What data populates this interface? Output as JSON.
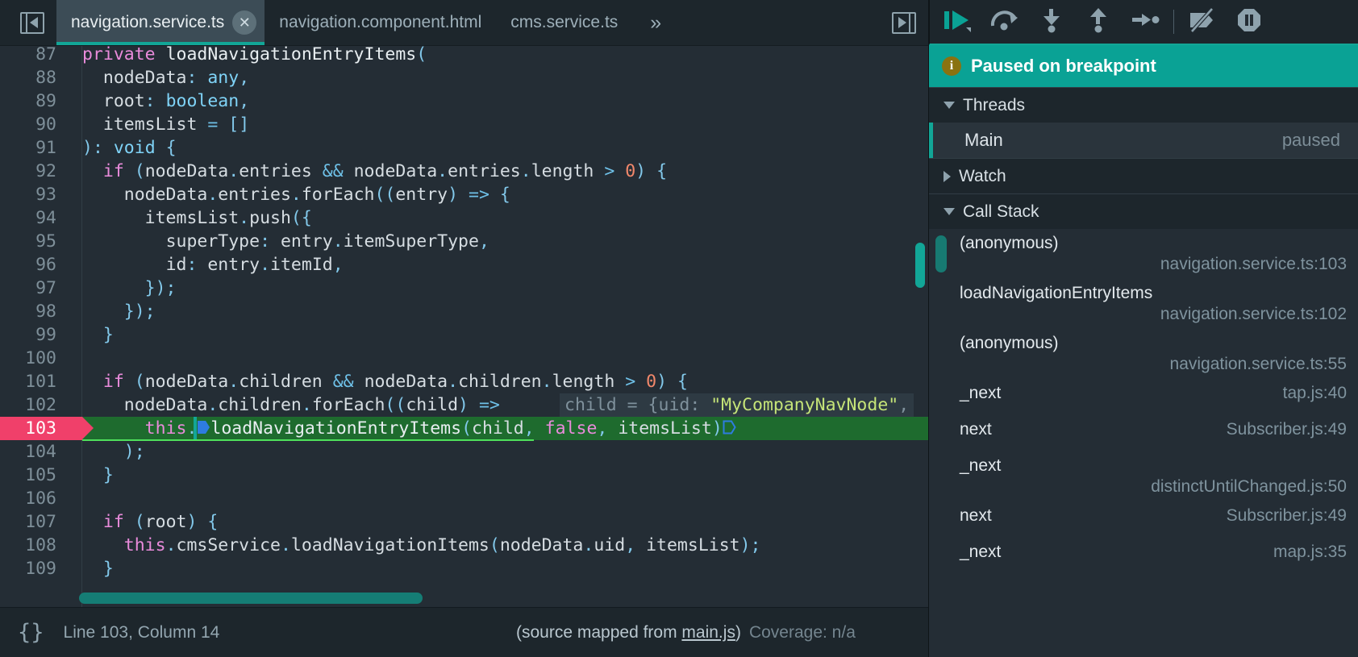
{
  "tabs": {
    "items": [
      {
        "label": "navigation.service.ts",
        "active": true,
        "closable": true
      },
      {
        "label": "navigation.component.html",
        "active": false,
        "closable": false
      },
      {
        "label": "cms.service.ts",
        "active": false,
        "closable": false
      }
    ],
    "more_label": "»",
    "close_glyph": "✕",
    "left_icon": "show-navigator-icon",
    "right_icon": "show-debugger-icon"
  },
  "editor": {
    "first_line_partial": "private loadNavigationEntryItems(",
    "lines": [
      {
        "no": "87",
        "partial": true
      },
      {
        "no": "88"
      },
      {
        "no": "89"
      },
      {
        "no": "90"
      },
      {
        "no": "91"
      },
      {
        "no": "92"
      },
      {
        "no": "93"
      },
      {
        "no": "94"
      },
      {
        "no": "95"
      },
      {
        "no": "96"
      },
      {
        "no": "97"
      },
      {
        "no": "98"
      },
      {
        "no": "99"
      },
      {
        "no": "100"
      },
      {
        "no": "101"
      },
      {
        "no": "102"
      },
      {
        "no": "103",
        "executing": true,
        "breakpoint": true
      },
      {
        "no": "104"
      },
      {
        "no": "105"
      },
      {
        "no": "106"
      },
      {
        "no": "107"
      },
      {
        "no": "108"
      },
      {
        "no": "109"
      }
    ],
    "inline_value_hint": "child = {uid: \"MyCompanyNavNode\",",
    "inline_value_key": "child = {uid: ",
    "inline_value_str": "\"MyCompanyNavNode\"",
    "code": {
      "l87": "private loadNavigationEntryItems(",
      "l88": "nodeData: any,",
      "l89": "root: boolean,",
      "l90": "itemsList = []",
      "l91": "): void {",
      "l92": "if (nodeData.entries && nodeData.entries.length > 0) {",
      "l93": "nodeData.entries.forEach((entry) => {",
      "l94": "itemsList.push({",
      "l95": "superType: entry.itemSuperType,",
      "l96": "id: entry.itemId,",
      "l97": "});",
      "l98": "});",
      "l99": "}",
      "l100": "",
      "l101": "if (nodeData.children && nodeData.children.length > 0) {",
      "l102": "nodeData.children.forEach((child) =>",
      "l103": "this.loadNavigationEntryItems(child, false, itemsList)",
      "l104": ");",
      "l105": "}",
      "l106": "",
      "l107": "if (root) {",
      "l108": "this.cmsService.loadNavigationItems(nodeData.uid, itemsList);",
      "l109": "}"
    }
  },
  "status": {
    "pretty_print_icon": "{}",
    "position": "Line 103, Column 14",
    "source_mapped_prefix": "(source mapped from ",
    "source_mapped_link": "main.js",
    "source_mapped_suffix": ")",
    "coverage": "Coverage: n/a"
  },
  "debugger": {
    "toolbar": [
      {
        "name": "resume-script-execution",
        "icon": "resume-icon"
      },
      {
        "name": "step-over-next-function-call",
        "icon": "step-over-icon"
      },
      {
        "name": "step-into-next-function-call",
        "icon": "step-into-icon"
      },
      {
        "name": "step-out-of-current-function",
        "icon": "step-out-icon"
      },
      {
        "name": "step",
        "icon": "step-icon"
      },
      {
        "name": "deactivate-breakpoints",
        "icon": "deactivate-breakpoints-icon"
      },
      {
        "name": "pause-on-exceptions",
        "icon": "pause-on-exceptions-icon"
      }
    ],
    "paused_banner": {
      "text": "Paused on breakpoint",
      "icon": "info-icon",
      "bg_color": "#0aa295"
    },
    "threads": {
      "title": "Threads",
      "expanded": true,
      "rows": [
        {
          "name": "Main",
          "state": "paused",
          "selected": true
        }
      ]
    },
    "watch": {
      "title": "Watch",
      "expanded": false
    },
    "call_stack": {
      "title": "Call Stack",
      "expanded": true,
      "frames": [
        {
          "name": "(anonymous)",
          "location": "navigation.service.ts:103",
          "selected": true,
          "wrap": true
        },
        {
          "name": "loadNavigationEntryItems",
          "location": "navigation.service.ts:102",
          "selected": false,
          "wrap": true
        },
        {
          "name": "(anonymous)",
          "location": "navigation.service.ts:55",
          "selected": false,
          "wrap": true
        },
        {
          "name": "_next",
          "location": "tap.js:40",
          "selected": false,
          "wrap": false
        },
        {
          "name": "next",
          "location": "Subscriber.js:49",
          "selected": false,
          "wrap": false
        },
        {
          "name": "_next",
          "location": "distinctUntilChanged.js:50",
          "selected": false,
          "wrap": true
        },
        {
          "name": "next",
          "location": "Subscriber.js:49",
          "selected": false,
          "wrap": false
        },
        {
          "name": "_next",
          "location": "map.js:35",
          "selected": false,
          "wrap": false
        }
      ]
    }
  },
  "colors": {
    "accent_teal": "#12a697",
    "breakpoint_pink": "#f0406a",
    "exec_green": "#1e6b2e",
    "panel_bg": "#242d35",
    "chrome_bg": "#1d262c"
  }
}
